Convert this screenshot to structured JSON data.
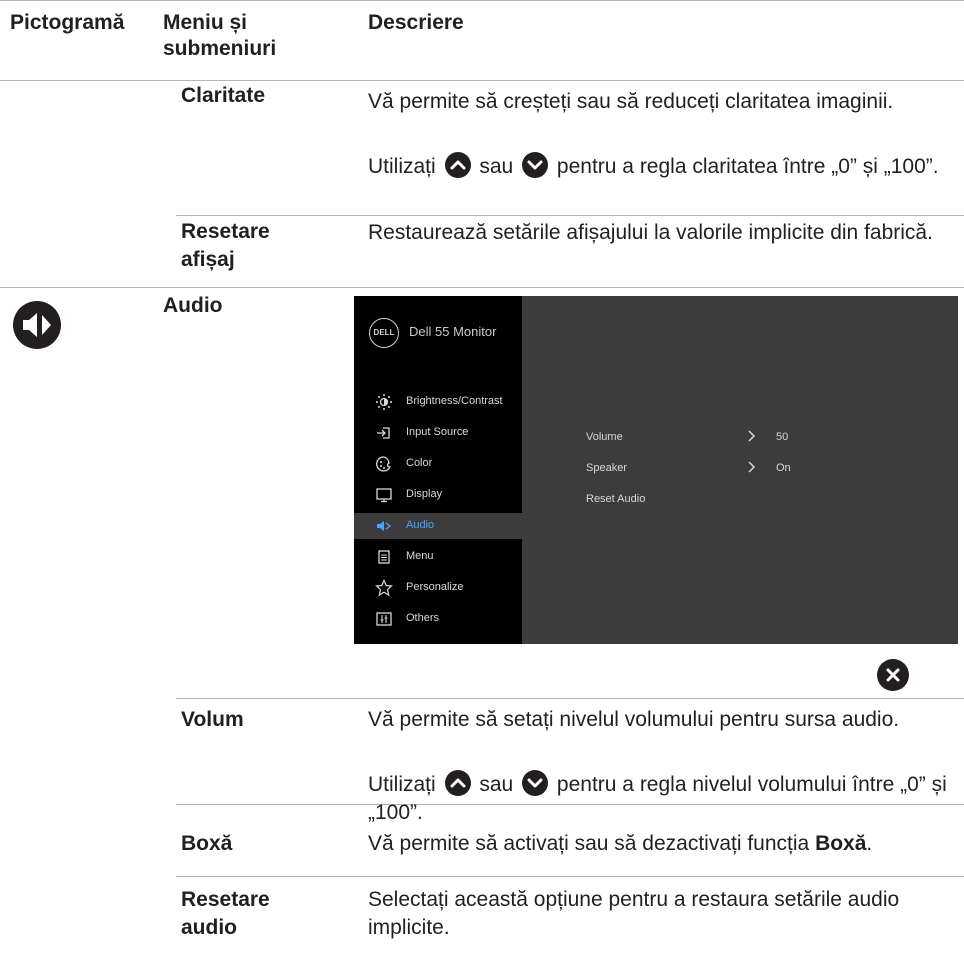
{
  "header": {
    "col1": "Pictogramă",
    "col2": "Meniu și submeniuri",
    "col3": "Descriere"
  },
  "rows": {
    "claritate": {
      "name": "Claritate",
      "desc1": "Vă permite să creșteți sau să reduceți claritatea imaginii.",
      "desc2_pre": "Utilizați",
      "desc2_mid": "sau",
      "desc2_post": "pentru a regla claritatea între „0” și „100”."
    },
    "resetare_afisaj": {
      "name_l1": "Resetare",
      "name_l2": "afișaj",
      "desc": "Restaurează setările afișajului la valorile implicite din fabrică."
    },
    "audio": {
      "name": "Audio",
      "icon": "speaker-icon"
    },
    "volum": {
      "name": "Volum",
      "desc1": "Vă permite să setați nivelul volumului pentru sursa audio.",
      "desc2_pre": "Utilizați",
      "desc2_mid": "sau",
      "desc2_post": "pentru a regla nivelul volumului între „0” și „100”."
    },
    "boxa": {
      "name": "Boxă",
      "desc_pre": "Vă permite să activați sau să dezactivați funcția",
      "desc_bold": "Boxă",
      "desc_end": "."
    },
    "resetare_audio": {
      "name_l1": "Resetare",
      "name_l2": "audio",
      "desc": "Selectați această opțiune pentru a restaura setările audio implicite."
    }
  },
  "osd": {
    "logo": "DELL",
    "title": "Dell 55 Monitor",
    "menu": [
      {
        "label": "Brightness/Contrast",
        "icon": "brightness-icon"
      },
      {
        "label": "Input Source",
        "icon": "input-source-icon"
      },
      {
        "label": "Color",
        "icon": "color-icon"
      },
      {
        "label": "Display",
        "icon": "display-icon"
      },
      {
        "label": "Audio",
        "icon": "audio-icon",
        "active": true
      },
      {
        "label": "Menu",
        "icon": "menu-icon"
      },
      {
        "label": "Personalize",
        "icon": "star-icon"
      },
      {
        "label": "Others",
        "icon": "others-icon"
      }
    ],
    "settings": [
      {
        "label": "Volume",
        "value": "50"
      },
      {
        "label": "Speaker",
        "value": "On"
      },
      {
        "label": "Reset Audio"
      }
    ],
    "accent": "#4aa3ff"
  },
  "icons": {
    "up": "up-button-icon",
    "down": "down-button-icon",
    "close": "close-icon"
  }
}
